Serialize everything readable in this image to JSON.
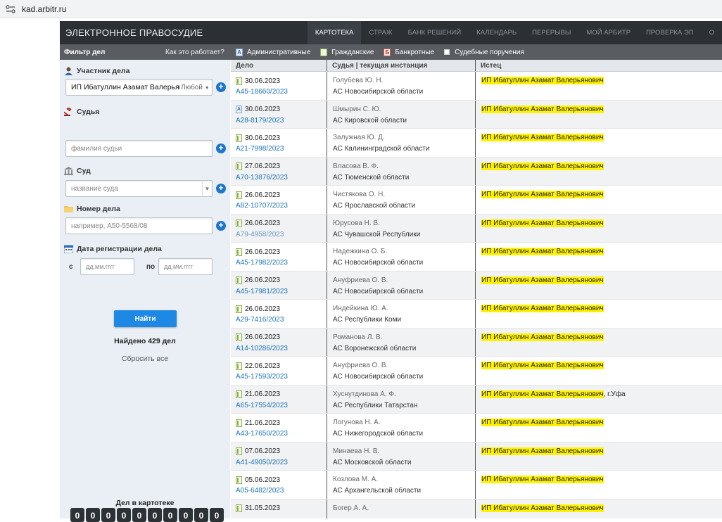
{
  "browser": {
    "url": "kad.arbitr.ru",
    "tune_icon": "tune-icon"
  },
  "nav": {
    "logo": "ЭЛЕКТРОННОЕ ПРАВОСУДИЕ",
    "items": [
      "КАРТОТЕКА",
      "СТРАЖ",
      "БАНК РЕШЕНИЙ",
      "КАЛЕНДАРЬ",
      "ПЕРЕРЫВЫ",
      "МОЙ АРБИТР",
      "ПРОВЕРКА ЭП",
      "О"
    ],
    "active_index": 0
  },
  "filterbar": {
    "title": "Фильтр дел",
    "howto": "Как это работает?",
    "types": [
      {
        "label": "Административные",
        "icon": "admin-case-icon"
      },
      {
        "label": "Гражданские",
        "icon": "civil-case-icon"
      },
      {
        "label": "Банкротные",
        "icon": "bankrupt-case-icon"
      },
      {
        "label": "Судебные поручения",
        "icon": "checkbox-icon"
      }
    ]
  },
  "sidebar": {
    "participant_label": "Участник дела",
    "participant_value": "ИП Ибатуллин Азамат Валерьянови",
    "participant_type": "Любой",
    "judge_label": "Судья",
    "judge_placeholder": "фамилия судьи",
    "court_label": "Суд",
    "court_placeholder": "название суда",
    "case_label": "Номер дела",
    "case_placeholder": "например, А50-5568/08",
    "date_label": "Дата регистрации дела",
    "date_from": "с",
    "date_to": "по",
    "date_placeholder": "дд.мм.гггг",
    "find": "Найти",
    "found": "Найдено 429 дел",
    "reset": "Сбросить все",
    "counter_label": "Дел в картотеке",
    "counter_digits": [
      "0",
      "0",
      "0",
      "0",
      "0",
      "0",
      "0",
      "0",
      "0",
      "0"
    ]
  },
  "table": {
    "headers": [
      "Дело",
      "Судья | текущая инстанция",
      "Истец"
    ],
    "rows": [
      {
        "date": "30.06.2023",
        "case": "А45-18660/2023",
        "judge": "Голубева Ю. Н.",
        "court": "АС Новосибирской области",
        "plaintiff": "ИП Ибатуллин Азамат Валерьянович",
        "suffix": "",
        "type": "civil",
        "visited": false
      },
      {
        "date": "30.06.2023",
        "case": "А28-8179/2023",
        "judge": "Шмырин С. Ю.",
        "court": "АС Кировской области",
        "plaintiff": "ИП Ибатуллин Азамат Валерьянович",
        "suffix": "",
        "type": "admin",
        "visited": false
      },
      {
        "date": "30.06.2023",
        "case": "А21-7998/2023",
        "judge": "Залужная Ю. Д.",
        "court": "АС Калининградской области",
        "plaintiff": "ИП Ибатуллин Азамат Валерьянович",
        "suffix": "",
        "type": "civil",
        "visited": false
      },
      {
        "date": "27.06.2023",
        "case": "А70-13876/2023",
        "judge": "Власова В. Ф.",
        "court": "АС Тюменской области",
        "plaintiff": "ИП Ибатуллин Азамат Валерьянович",
        "suffix": "",
        "type": "civil",
        "visited": false
      },
      {
        "date": "26.06.2023",
        "case": "А82-10707/2023",
        "judge": "Чистякова О. Н.",
        "court": "АС Ярославской области",
        "plaintiff": "ИП Ибатуллин Азамат Валерьянович",
        "suffix": "",
        "type": "civil",
        "visited": false
      },
      {
        "date": "26.06.2023",
        "case": "А79-4958/2023",
        "judge": "Юрусова Н. В.",
        "court": "АС Чувашской Республики",
        "plaintiff": "ИП Ибатуллин Азамат Валерьянович",
        "suffix": "",
        "type": "civil",
        "visited": true
      },
      {
        "date": "26.06.2023",
        "case": "А45-17982/2023",
        "judge": "Надежкина О. Б.",
        "court": "АС Новосибирской области",
        "plaintiff": "ИП Ибатуллин Азамат Валерьянович",
        "suffix": "",
        "type": "civil",
        "visited": false
      },
      {
        "date": "26.06.2023",
        "case": "А45-17981/2023",
        "judge": "Ануфриева О. В.",
        "court": "АС Новосибирской области",
        "plaintiff": "ИП Ибатуллин Азамат Валерьянович",
        "suffix": "",
        "type": "civil",
        "visited": false
      },
      {
        "date": "26.06.2023",
        "case": "А29-7416/2023",
        "judge": "Индейкина Ю. А.",
        "court": "АС Республики Коми",
        "plaintiff": "ИП Ибатуллин Азамат Валерьянович",
        "suffix": "",
        "type": "civil",
        "visited": false
      },
      {
        "date": "26.06.2023",
        "case": "А14-10286/2023",
        "judge": "Романова Л. В.",
        "court": "АС Воронежской области",
        "plaintiff": "ИП Ибатуллин Азамат Валерьянович",
        "suffix": "",
        "type": "civil",
        "visited": false
      },
      {
        "date": "22.06.2023",
        "case": "А45-17593/2023",
        "judge": "Ануфриева О. В.",
        "court": "АС Новосибирской области",
        "plaintiff": "ИП Ибатуллин Азамат Валерьянович",
        "suffix": "",
        "type": "civil",
        "visited": false
      },
      {
        "date": "21.06.2023",
        "case": "А65-17554/2023",
        "judge": "Хуснутдинова А. Ф.",
        "court": "АС Республики Татарстан",
        "plaintiff": "ИП Ибатуллин Азамат Валерьянович",
        "suffix": ", г.Уфа",
        "type": "civil",
        "visited": false
      },
      {
        "date": "21.06.2023",
        "case": "А43-17650/2023",
        "judge": "Логунова Н. А.",
        "court": "АС Нижегородской области",
        "plaintiff": "ИП Ибатуллин Азамат Валерьянович",
        "suffix": "",
        "type": "civil",
        "visited": false
      },
      {
        "date": "07.06.2023",
        "case": "А41-49050/2023",
        "judge": "Минаева Н. В.",
        "court": "АС Московской области",
        "plaintiff": "ИП Ибатуллин Азамат Валерьянович",
        "suffix": "",
        "type": "civil",
        "visited": false
      },
      {
        "date": "05.06.2023",
        "case": "А05-6482/2023",
        "judge": "Козлова М. А.",
        "court": "АС Архангельской области",
        "plaintiff": "ИП Ибатуллин Азамат Валерьянович",
        "suffix": "",
        "type": "civil",
        "visited": false
      },
      {
        "date": "31.05.2023",
        "case": "",
        "judge": "Богер А. А.",
        "court": "",
        "plaintiff": "ИП Ибатуллин Азамат Валерьянович",
        "suffix": "",
        "type": "civil",
        "visited": false
      }
    ]
  },
  "colors": {
    "nav_bg": "#2c3035",
    "filter_bg": "#595d61",
    "sidebar_bg": "#e9eff5",
    "link": "#1b73b8",
    "highlight": "#fff200",
    "button": "#1e88e5"
  }
}
